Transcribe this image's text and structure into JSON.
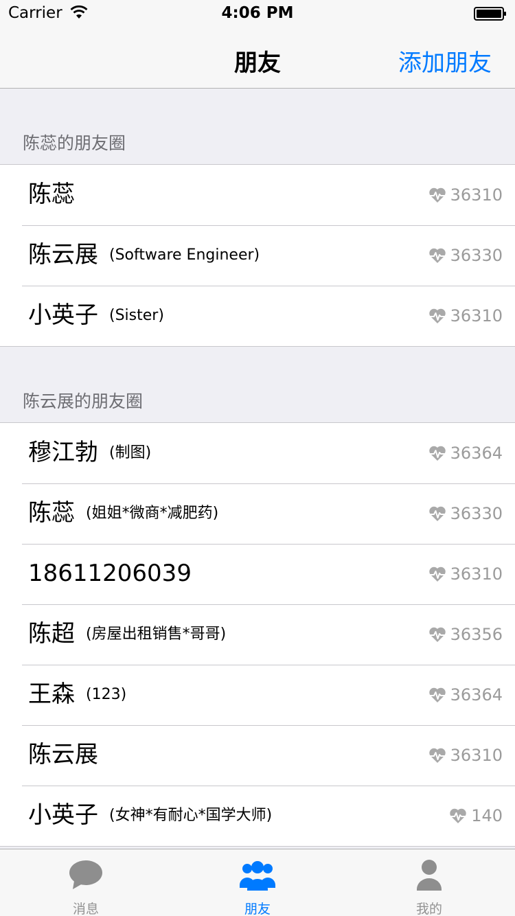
{
  "status_bar": {
    "carrier": "Carrier",
    "time": "4:06 PM"
  },
  "nav": {
    "title": "朋友",
    "add_label": "添加朋友"
  },
  "sections": [
    {
      "header": "陈蕊的朋友圈",
      "rows": [
        {
          "name": "陈蕊",
          "note": "",
          "score": "36310"
        },
        {
          "name": "陈云展",
          "note": "(Software Engineer)",
          "score": "36330"
        },
        {
          "name": "小英子",
          "note": "(Sister)",
          "score": "36310"
        }
      ]
    },
    {
      "header": "陈云展的朋友圈",
      "rows": [
        {
          "name": "穆江勃",
          "note": "(制图)",
          "score": "36364"
        },
        {
          "name": "陈蕊",
          "note": "(姐姐*微商*减肥药)",
          "score": "36330"
        },
        {
          "name": "18611206039",
          "note": "",
          "score": "36310"
        },
        {
          "name": "陈超",
          "note": "(房屋出租销售*哥哥)",
          "score": "36356"
        },
        {
          "name": "王森",
          "note": "(123)",
          "score": "36364"
        },
        {
          "name": "陈云展",
          "note": "",
          "score": "36310"
        },
        {
          "name": "小英子",
          "note": "(女神*有耐心*国学大师)",
          "score": "140"
        }
      ]
    }
  ],
  "tabs": [
    {
      "label": "消息",
      "icon": "chat-bubble-icon",
      "active": false
    },
    {
      "label": "朋友",
      "icon": "people-group-icon",
      "active": true
    },
    {
      "label": "我的",
      "icon": "person-icon",
      "active": false
    }
  ],
  "colors": {
    "accent": "#007aff",
    "inactive": "#929292",
    "score": "#9b9b9b"
  }
}
